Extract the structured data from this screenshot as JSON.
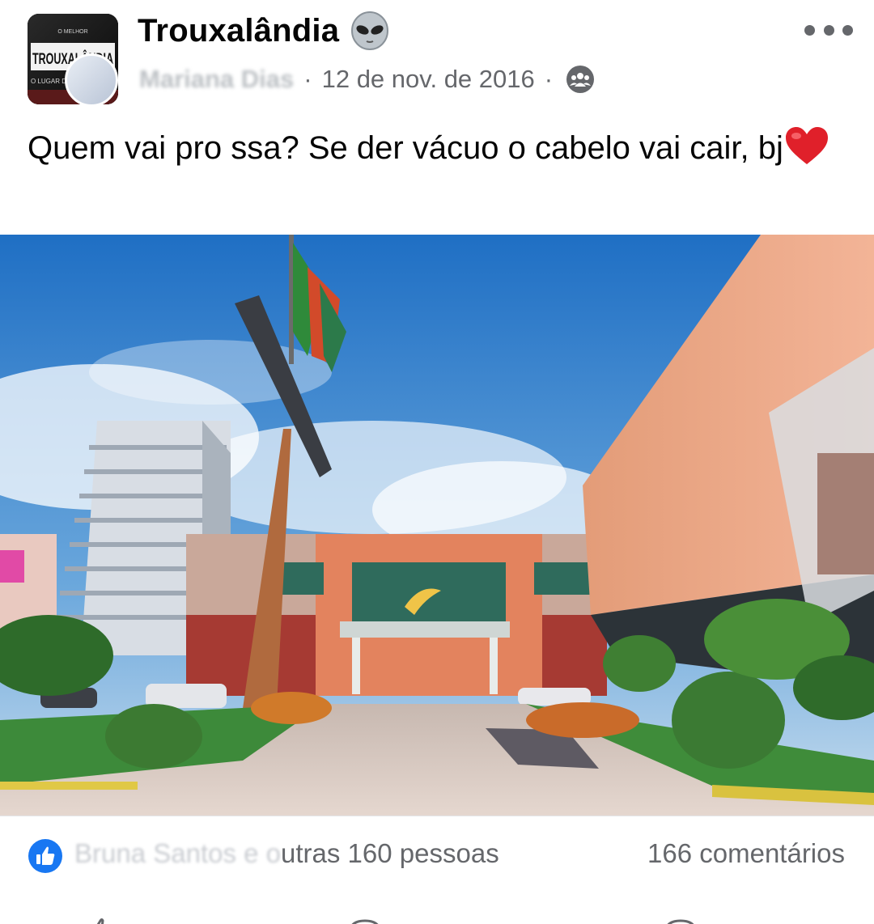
{
  "post": {
    "group_name": "Trouxalândia",
    "group_avatar_text": {
      "top": "O MELHOR",
      "main": "TROUXALÂNDIA",
      "bottom": "O LUGAR DE TROUXA"
    },
    "author_name": "Mariana Dias",
    "author_visible_suffix": "as",
    "separator": "·",
    "date": "12 de nov. de 2016",
    "text": "Quem vai pro ssa? Se der vácuo o cabelo vai cair, bj",
    "audience_icon": "group-audience-icon",
    "more_icon": "more-options-icon"
  },
  "reactions": {
    "reactor_blurred": "Bruna Santos e o",
    "reactor_tail": "utras 160 pessoas",
    "comments": "166 comentários",
    "icon": "like-icon",
    "colors": {
      "like_blue": "#1877f2",
      "secondary_text": "#65676b"
    }
  },
  "actions": [
    {
      "icon": "like-action-icon"
    },
    {
      "icon": "comment-action-icon"
    },
    {
      "icon": "share-action-icon"
    }
  ]
}
